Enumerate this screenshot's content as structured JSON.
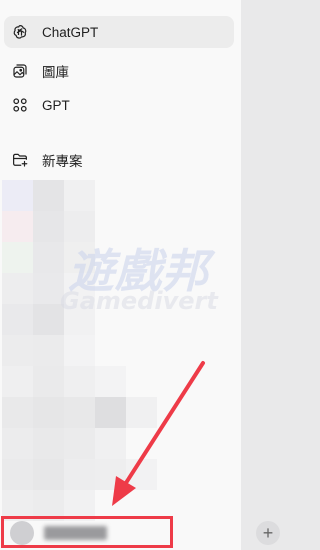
{
  "sidebar": {
    "items": [
      {
        "label": "ChatGPT",
        "icon": "chatgpt-logo-icon",
        "active": true
      },
      {
        "label": "圖庫",
        "icon": "library-icon",
        "active": false
      },
      {
        "label": "GPT",
        "icon": "grid-icon",
        "active": false
      },
      {
        "label": "新專案",
        "icon": "new-folder-icon",
        "active": false
      }
    ]
  },
  "footer": {
    "username": "Username",
    "new_button_label": "+"
  },
  "watermark": {
    "text_cn": "遊戲邦",
    "text_en": "Gamedivert"
  },
  "colors": {
    "sidebar_bg": "#f9f9f9",
    "active_item_bg": "#ececec",
    "annotation_red": "#ee3b48",
    "main_bg": "#e9e9ea"
  }
}
